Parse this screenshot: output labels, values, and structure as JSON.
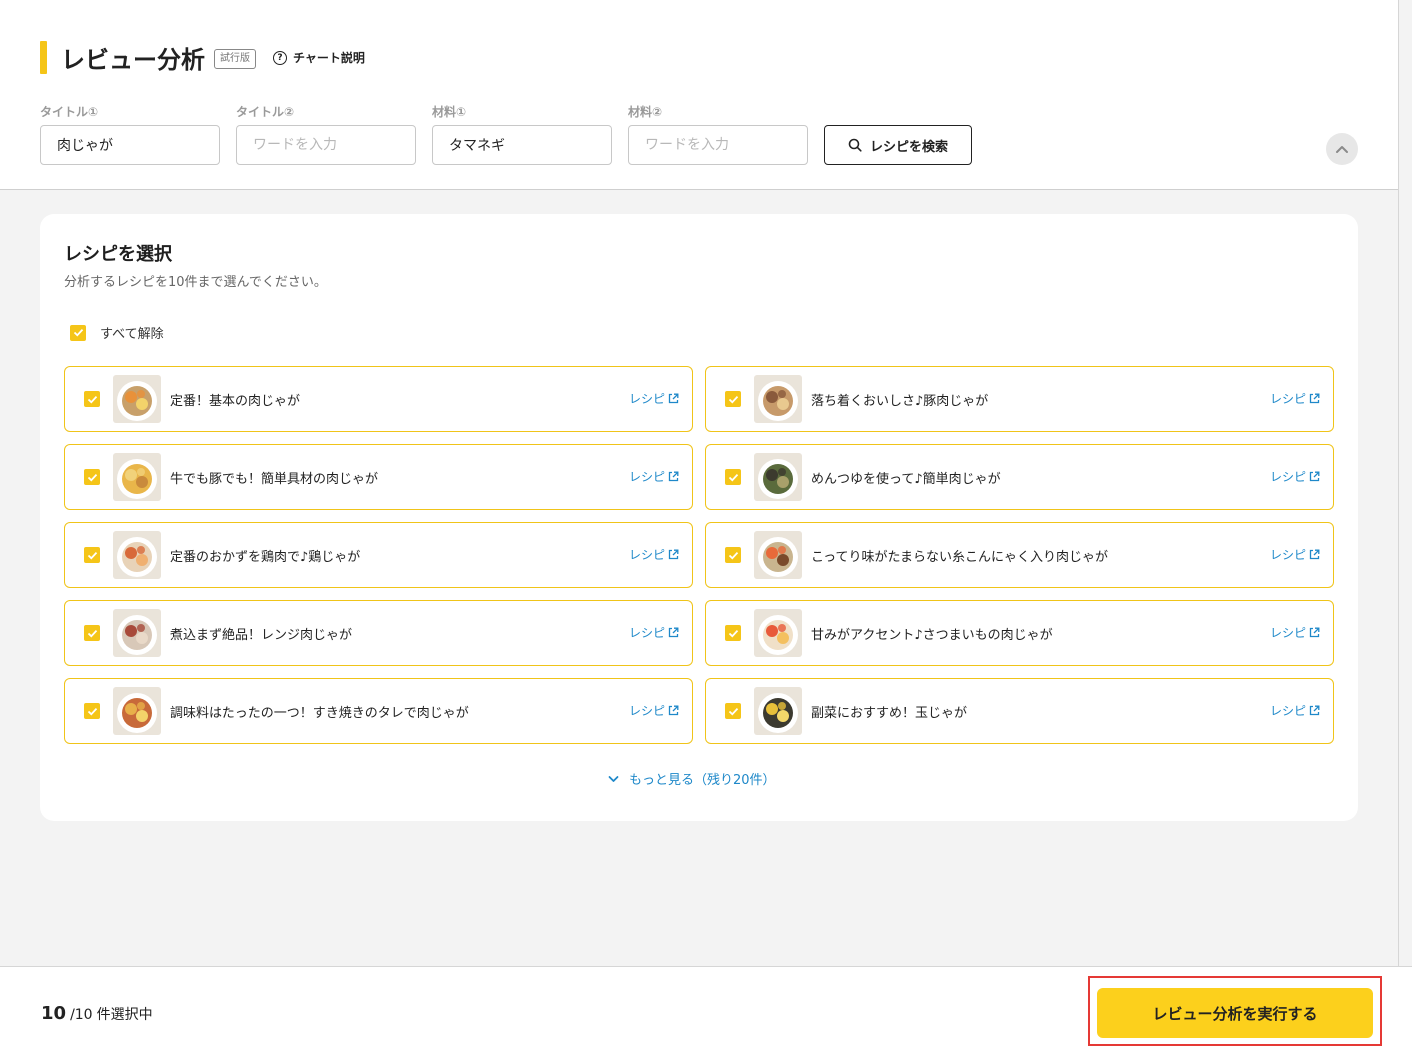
{
  "header": {
    "title": "レビュー分析",
    "badge": "試行版",
    "help_label": "チャート説明",
    "fields": [
      {
        "label": "タイトル①",
        "value": "肉じゃが",
        "placeholder": ""
      },
      {
        "label": "タイトル②",
        "value": "",
        "placeholder": "ワードを入力"
      },
      {
        "label": "材料①",
        "value": "タマネギ",
        "placeholder": ""
      },
      {
        "label": "材料②",
        "value": "",
        "placeholder": "ワードを入力"
      }
    ],
    "search_button": "レシピを検索"
  },
  "card": {
    "title": "レシピを選択",
    "subtitle": "分析するレシピを10件まで選んでください。",
    "select_all_label": "すべて解除",
    "link_label": "レシピ",
    "recipes": [
      {
        "title": "定番！基本の肉じゃが",
        "checked": true
      },
      {
        "title": "落ち着くおいしさ♪豚肉じゃが",
        "checked": true
      },
      {
        "title": "牛でも豚でも！簡単具材の肉じゃが",
        "checked": true
      },
      {
        "title": "めんつゆを使って♪簡単肉じゃが",
        "checked": true
      },
      {
        "title": "定番のおかずを鶏肉で♪鶏じゃが",
        "checked": true
      },
      {
        "title": "こってり味がたまらない糸こんにゃく入り肉じゃが",
        "checked": true
      },
      {
        "title": "煮込まず絶品！レンジ肉じゃが",
        "checked": true
      },
      {
        "title": "甘みがアクセント♪さつまいもの肉じゃが",
        "checked": true
      },
      {
        "title": "調味料はたったの一つ！すき焼きのタレで肉じゃが",
        "checked": true
      },
      {
        "title": "副菜におすすめ！玉じゃが",
        "checked": true
      }
    ],
    "more_label": "もっと見る（残り20件）"
  },
  "footer": {
    "selected_count": "10",
    "total": "/10",
    "suffix": "件選択中",
    "run_button": "レビュー分析を実行する"
  },
  "colors": {
    "accent": "#f5c518",
    "run_button": "#fcd01c",
    "link": "#1e88c9",
    "highlight_border": "#e53935"
  }
}
